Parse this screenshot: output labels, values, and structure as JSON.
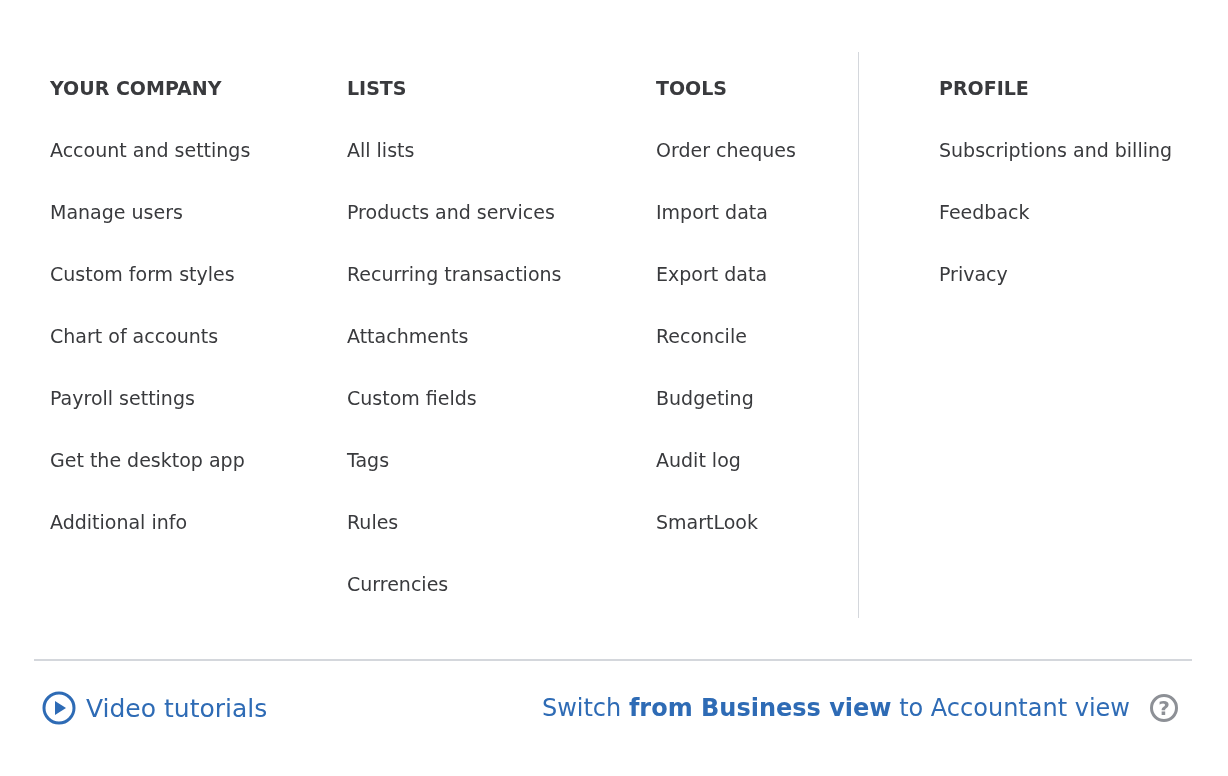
{
  "columns": [
    {
      "heading": "YOUR COMPANY",
      "items": [
        "Account and settings",
        "Manage users",
        "Custom form styles",
        "Chart of accounts",
        "Payroll settings",
        "Get the desktop app",
        "Additional info"
      ]
    },
    {
      "heading": "LISTS",
      "items": [
        "All lists",
        "Products and services",
        "Recurring transactions",
        "Attachments",
        "Custom fields",
        "Tags",
        "Rules",
        "Currencies"
      ]
    },
    {
      "heading": "TOOLS",
      "items": [
        "Order cheques",
        "Import data",
        "Export data",
        "Reconcile",
        "Budgeting",
        "Audit log",
        "SmartLook"
      ]
    },
    {
      "heading": "PROFILE",
      "items": [
        "Subscriptions and billing",
        "Feedback",
        "Privacy"
      ]
    }
  ],
  "footer": {
    "video_link": "Video tutorials",
    "switch_link": "Switch **from Business view** to Accountant view",
    "help": "?"
  }
}
